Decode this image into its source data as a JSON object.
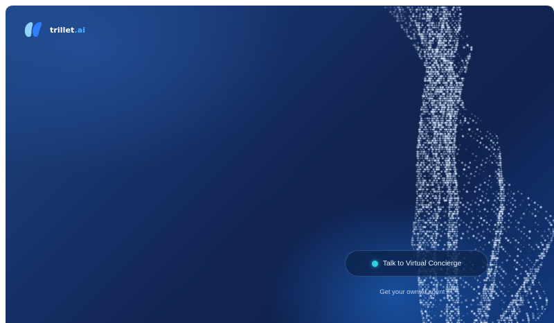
{
  "brand": {
    "name_part1": "trill",
    "name_part2": "et",
    "name_part3": ".ai",
    "logo_icon": "trillet-logo-mark",
    "accent_color": "#3fb6ff"
  },
  "cta": {
    "primary_label": "Talk to Virtual Concierge",
    "status_color": "#2fd2e0",
    "secondary_label": "Get your own AI agent",
    "secondary_arrow": "→"
  },
  "colors": {
    "background_dark": "#10224e",
    "background_light": "#1e4583"
  }
}
